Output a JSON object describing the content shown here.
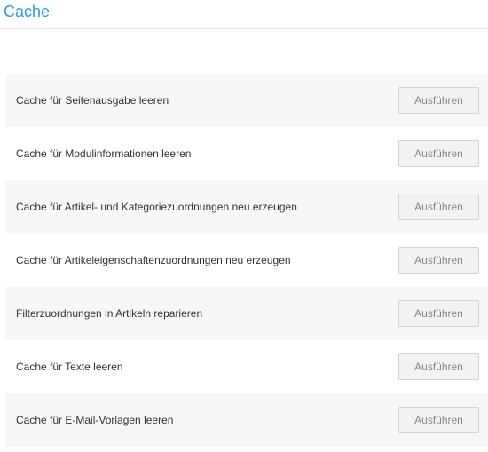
{
  "header": {
    "title": "Cache"
  },
  "actions": [
    {
      "label": "Cache für Seitenausgabe leeren",
      "button": "Ausführen"
    },
    {
      "label": "Cache für Modulinformationen leeren",
      "button": "Ausführen"
    },
    {
      "label": "Cache für Artikel- und Kategoriezuordnungen neu erzeugen",
      "button": "Ausführen"
    },
    {
      "label": "Cache für Artikeleigenschaftenzuordnungen neu erzeugen",
      "button": "Ausführen"
    },
    {
      "label": "Filterzuordnungen in Artikeln reparieren",
      "button": "Ausführen"
    },
    {
      "label": "Cache für Texte leeren",
      "button": "Ausführen"
    },
    {
      "label": "Cache für E-Mail-Vorlagen leeren",
      "button": "Ausführen"
    }
  ],
  "colors": {
    "title": "#2a9fd8",
    "row_shaded": "#f7f7f7",
    "button_bg": "#f2f2f2",
    "button_border": "#d2d2d2",
    "button_text": "#888888"
  }
}
